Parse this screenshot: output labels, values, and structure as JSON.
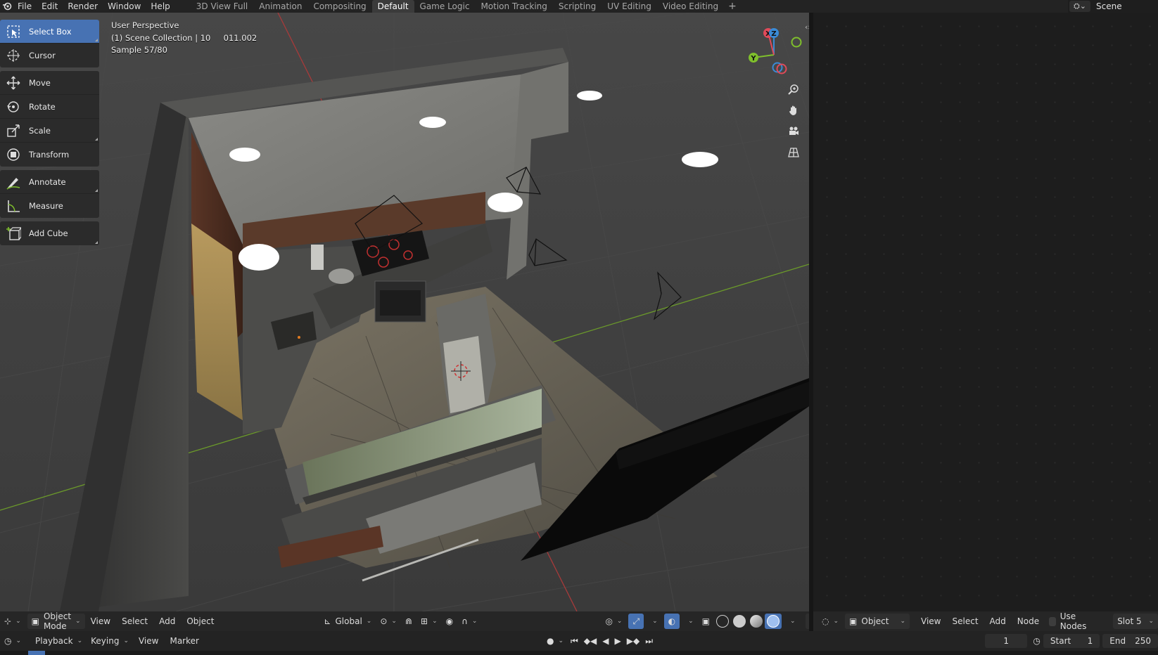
{
  "topbar": {
    "menus": [
      "File",
      "Edit",
      "Render",
      "Window",
      "Help"
    ],
    "workspace_tabs": [
      "3D View Full",
      "Animation",
      "Compositing",
      "Default",
      "Game Logic",
      "Motion Tracking",
      "Scripting",
      "UV Editing",
      "Video Editing"
    ],
    "active_tab": "Default",
    "add_tab_symbol": "+",
    "scene_name": "Scene"
  },
  "viewport": {
    "overlay_line1": "User Perspective",
    "overlay_line2": "(1) Scene Collection | 10     011.002",
    "overlay_line3": "Sample 57/80",
    "gizmo_labels": {
      "x": "X",
      "y": "Y",
      "z": "Z"
    },
    "axis_colors": {
      "x": "#e04a5a",
      "y": "#7fbf2c",
      "z": "#3a8bd6"
    }
  },
  "toolbar": {
    "tools": [
      {
        "label": "Select Box",
        "icon": "select-box-icon",
        "active": true
      },
      {
        "label": "Cursor",
        "icon": "cursor-icon"
      },
      {
        "label": "Move",
        "icon": "move-icon"
      },
      {
        "label": "Rotate",
        "icon": "rotate-icon"
      },
      {
        "label": "Scale",
        "icon": "scale-icon"
      },
      {
        "label": "Transform",
        "icon": "transform-icon"
      },
      {
        "label": "Annotate",
        "icon": "annotate-icon"
      },
      {
        "label": "Measure",
        "icon": "measure-icon"
      },
      {
        "label": "Add Cube",
        "icon": "add-cube-icon"
      }
    ]
  },
  "viewport_header": {
    "mode": "Object Mode",
    "menus": [
      "View",
      "Select",
      "Add",
      "Object"
    ],
    "orientation": "Global"
  },
  "node_editor_header": {
    "type": "Object",
    "menus": [
      "View",
      "Select",
      "Add",
      "Node"
    ],
    "use_nodes_label": "Use Nodes",
    "slot": "Slot 5"
  },
  "timeline": {
    "menus": [
      "Playback",
      "Keying",
      "View",
      "Marker"
    ],
    "current_frame": "1",
    "start_label": "Start",
    "start_value": "1",
    "end_label": "End",
    "end_value": "250"
  },
  "colors": {
    "accent": "#4772b3"
  }
}
